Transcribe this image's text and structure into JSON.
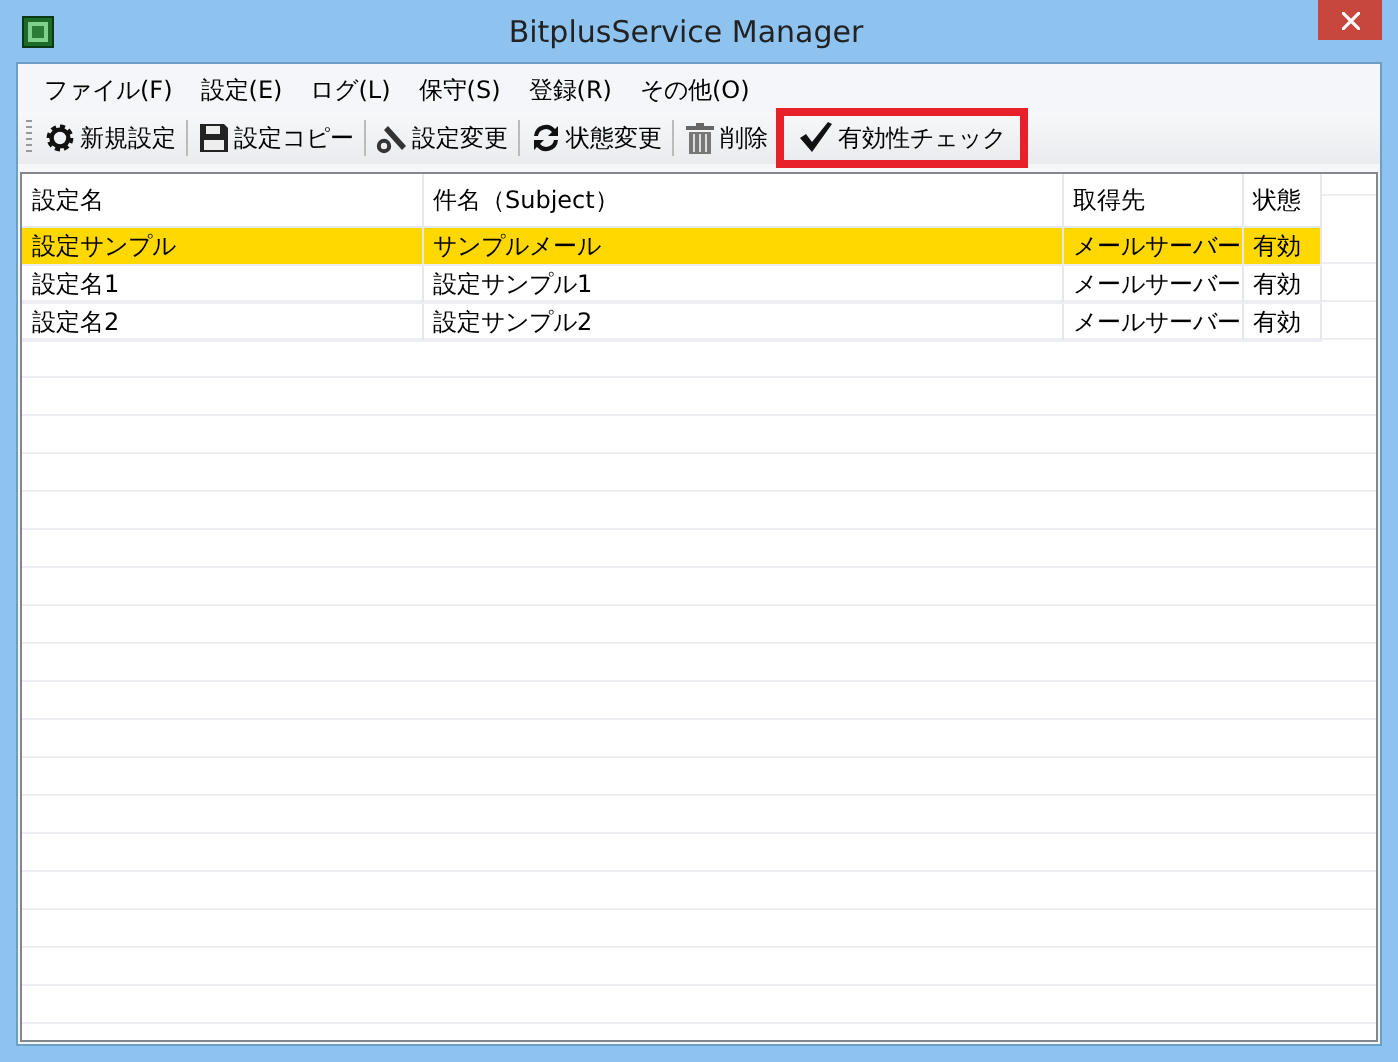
{
  "window": {
    "title": "BitplusService Manager"
  },
  "menu": [
    "ファイル(F)",
    "設定(E)",
    "ログ(L)",
    "保守(S)",
    "登録(R)",
    "その他(O)"
  ],
  "toolbar": [
    {
      "kind": "gear",
      "label": "新規設定",
      "highlighted": false
    },
    {
      "kind": "save",
      "label": "設定コピー",
      "highlighted": false
    },
    {
      "kind": "tools",
      "label": "設定変更",
      "highlighted": false
    },
    {
      "kind": "refresh",
      "label": "状態変更",
      "highlighted": false
    },
    {
      "kind": "trash",
      "label": "削除",
      "highlighted": false
    },
    {
      "kind": "check",
      "label": "有効性チェック",
      "highlighted": true
    }
  ],
  "table": {
    "columns": [
      "設定名",
      "件名（Subject）",
      "取得先",
      "状態"
    ],
    "rows": [
      {
        "cells": [
          "設定サンプル",
          "サンプルメール",
          "メールサーバー",
          "有効"
        ],
        "selected": true
      },
      {
        "cells": [
          "設定名1",
          "設定サンプル1",
          "メールサーバー",
          "有効"
        ],
        "selected": false
      },
      {
        "cells": [
          "設定名2",
          "設定サンプル2",
          "メールサーバー",
          "有効"
        ],
        "selected": false
      }
    ]
  }
}
